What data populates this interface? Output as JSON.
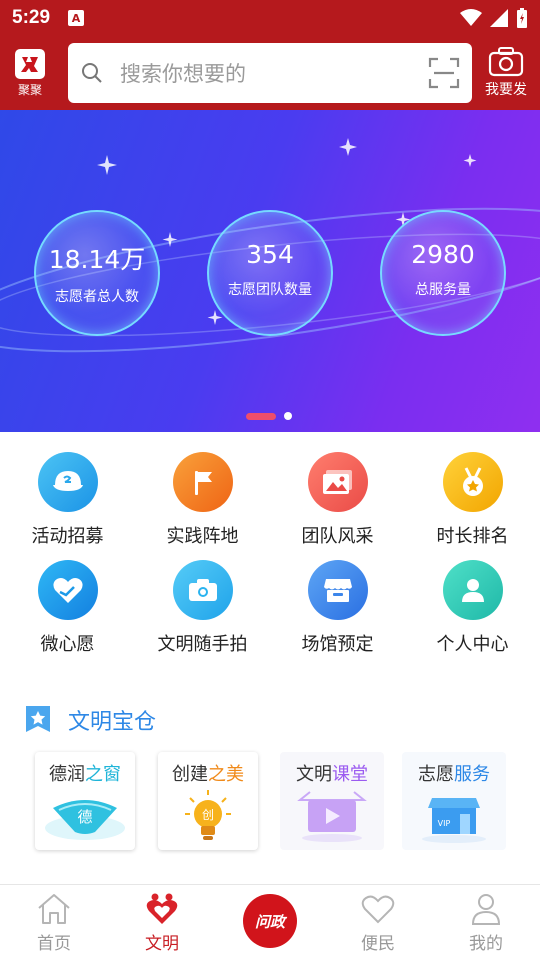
{
  "status": {
    "time": "5:29",
    "notification_icon": "A"
  },
  "header": {
    "logo_label": "聚聚",
    "search_placeholder": "搜索你想要的",
    "camera_label": "我要发"
  },
  "banner": {
    "stats": [
      {
        "value": "18.14万",
        "label": "志愿者总人数"
      },
      {
        "value": "354",
        "label": "志愿团队数量"
      },
      {
        "value": "2980",
        "label": "总服务量"
      }
    ],
    "page_count": 2,
    "active_page": 1
  },
  "grid": {
    "items": [
      {
        "label": "活动招募",
        "icon": "cap-icon",
        "color": "#2aa8ec"
      },
      {
        "label": "实践阵地",
        "icon": "flag-icon",
        "color": "#f27a1a"
      },
      {
        "label": "团队风采",
        "icon": "gallery-icon",
        "color": "#f0574f"
      },
      {
        "label": "时长排名",
        "icon": "medal-icon",
        "color": "#f5b400"
      },
      {
        "label": "微心愿",
        "icon": "heart-hand-icon",
        "color": "#1c9ae8"
      },
      {
        "label": "文明随手拍",
        "icon": "camera-icon",
        "color": "#29b3ef"
      },
      {
        "label": "场馆预定",
        "icon": "store-icon",
        "color": "#3d86ea"
      },
      {
        "label": "个人中心",
        "icon": "person-icon",
        "color": "#2cc9b5"
      }
    ]
  },
  "section": {
    "title": "文明宝仓"
  },
  "cards": [
    {
      "prefix": "德润",
      "highlight": "之窗",
      "color": "#1fb4d8"
    },
    {
      "prefix": "创建",
      "highlight": "之美",
      "color": "#f08a1a"
    },
    {
      "prefix": "文明",
      "highlight": "课堂",
      "color": "#9b5bf0"
    },
    {
      "prefix": "志愿",
      "highlight": "服务",
      "color": "#2e88e6"
    }
  ],
  "card_badges": {
    "de": "德",
    "chuang": "创",
    "vip": "VIP"
  },
  "tabbar": {
    "tabs": [
      {
        "label": "首页"
      },
      {
        "label": "文明"
      },
      {
        "label": "便民"
      },
      {
        "label": "我的"
      }
    ],
    "center_label": "问政",
    "active_tab": "文明"
  },
  "colors": {
    "brand_red": "#b5191d",
    "accent_blue": "#2e88e6"
  }
}
